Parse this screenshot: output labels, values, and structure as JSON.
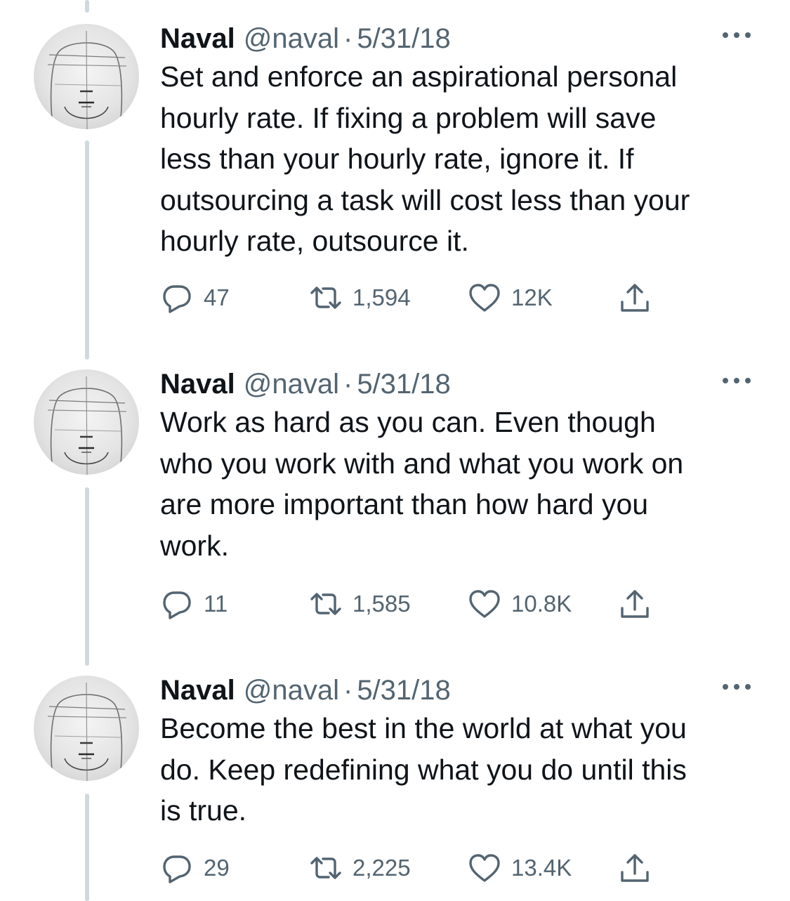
{
  "tweets": [
    {
      "author_name": "Naval",
      "handle": "@naval",
      "separator": "·",
      "date": "5/31/18",
      "text": "Set and enforce an aspirational personal\nhourly rate. If fixing a problem will save\nless than your hourly rate, ignore it. If\noutsourcing a task will cost less than your\nhourly rate, outsource it.",
      "replies": "47",
      "retweets": "1,594",
      "likes": "12K"
    },
    {
      "author_name": "Naval",
      "handle": "@naval",
      "separator": "·",
      "date": "5/31/18",
      "text": "Work as hard as you can. Even though\nwho you work with and what you work on\nare more important than how hard you\nwork.",
      "replies": "11",
      "retweets": "1,585",
      "likes": "10.8K"
    },
    {
      "author_name": "Naval",
      "handle": "@naval",
      "separator": "·",
      "date": "5/31/18",
      "text": "Become the best in the world at what you\ndo. Keep redefining what you do until this\nis true.",
      "replies": "29",
      "retweets": "2,225",
      "likes": "13.4K"
    }
  ],
  "icons": {
    "reply": "reply-icon",
    "retweet": "retweet-icon",
    "like": "heart-icon",
    "share": "share-icon",
    "more": "more-options-icon"
  },
  "colors": {
    "text_primary": "#0f1419",
    "text_secondary": "#536471",
    "thread_line": "#cfd9de",
    "background": "#ffffff"
  }
}
